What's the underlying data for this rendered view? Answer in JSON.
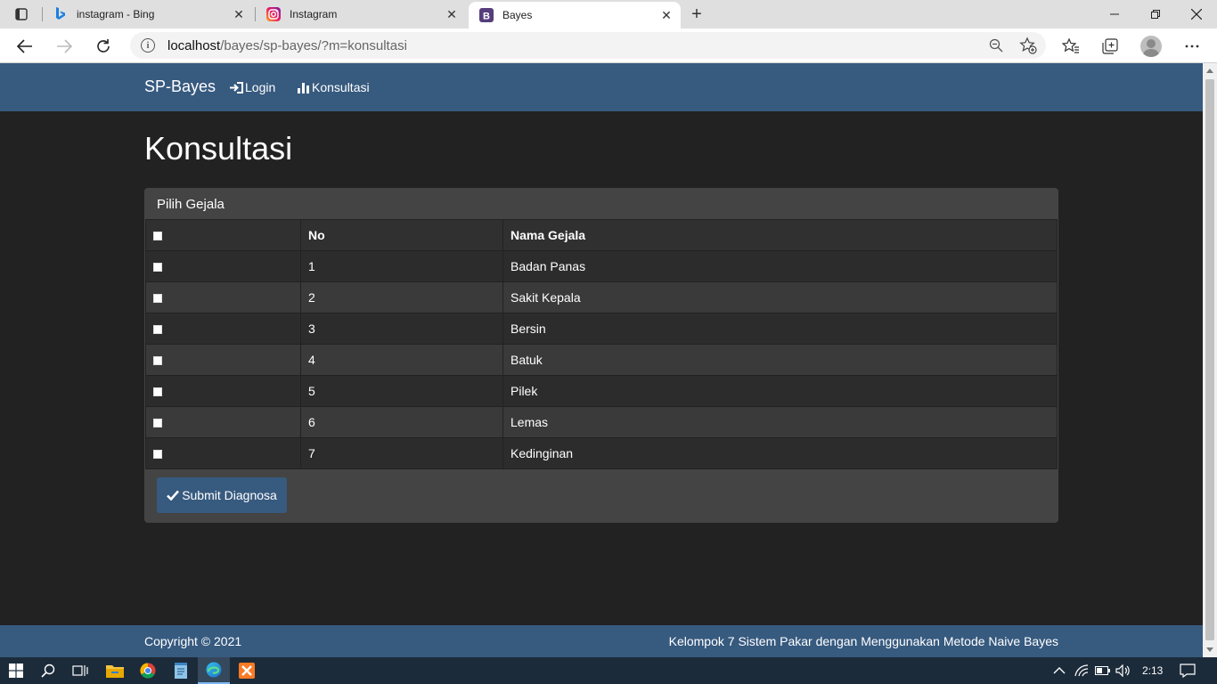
{
  "browser": {
    "tabs": [
      {
        "title": "instagram - Bing",
        "favicon": "bing-icon"
      },
      {
        "title": "Instagram",
        "favicon": "instagram-icon"
      },
      {
        "title": "Bayes",
        "favicon": "bootstrap-icon",
        "favicon_letter": "B",
        "active": true
      }
    ],
    "url_host": "localhost",
    "url_path": "/bayes/sp-bayes/?m=konsultasi"
  },
  "navbar": {
    "brand": "SP-Bayes",
    "links": [
      {
        "label": "Login",
        "icon": "login-icon"
      },
      {
        "label": "Konsultasi",
        "icon": "bar-chart-icon"
      }
    ]
  },
  "main": {
    "heading": "Konsultasi",
    "panel_title": "Pilih Gejala",
    "table": {
      "headers": [
        "",
        "No",
        "Nama Gejala"
      ],
      "rows": [
        {
          "no": "1",
          "name": "Badan Panas"
        },
        {
          "no": "2",
          "name": "Sakit Kepala"
        },
        {
          "no": "3",
          "name": "Bersin"
        },
        {
          "no": "4",
          "name": "Batuk"
        },
        {
          "no": "5",
          "name": "Pilek"
        },
        {
          "no": "6",
          "name": "Lemas"
        },
        {
          "no": "7",
          "name": "Kedinginan"
        }
      ]
    },
    "submit_label": "Submit Diagnosa"
  },
  "footer": {
    "copyright": "Copyright © 2021",
    "credit": "Kelompok 7 Sistem Pakar dengan Menggunakan Metode Naive Bayes"
  },
  "taskbar": {
    "clock": "2:13"
  },
  "colors": {
    "navbar": "#375a7f",
    "page_bg": "#222222",
    "panel_bg": "#444444"
  }
}
